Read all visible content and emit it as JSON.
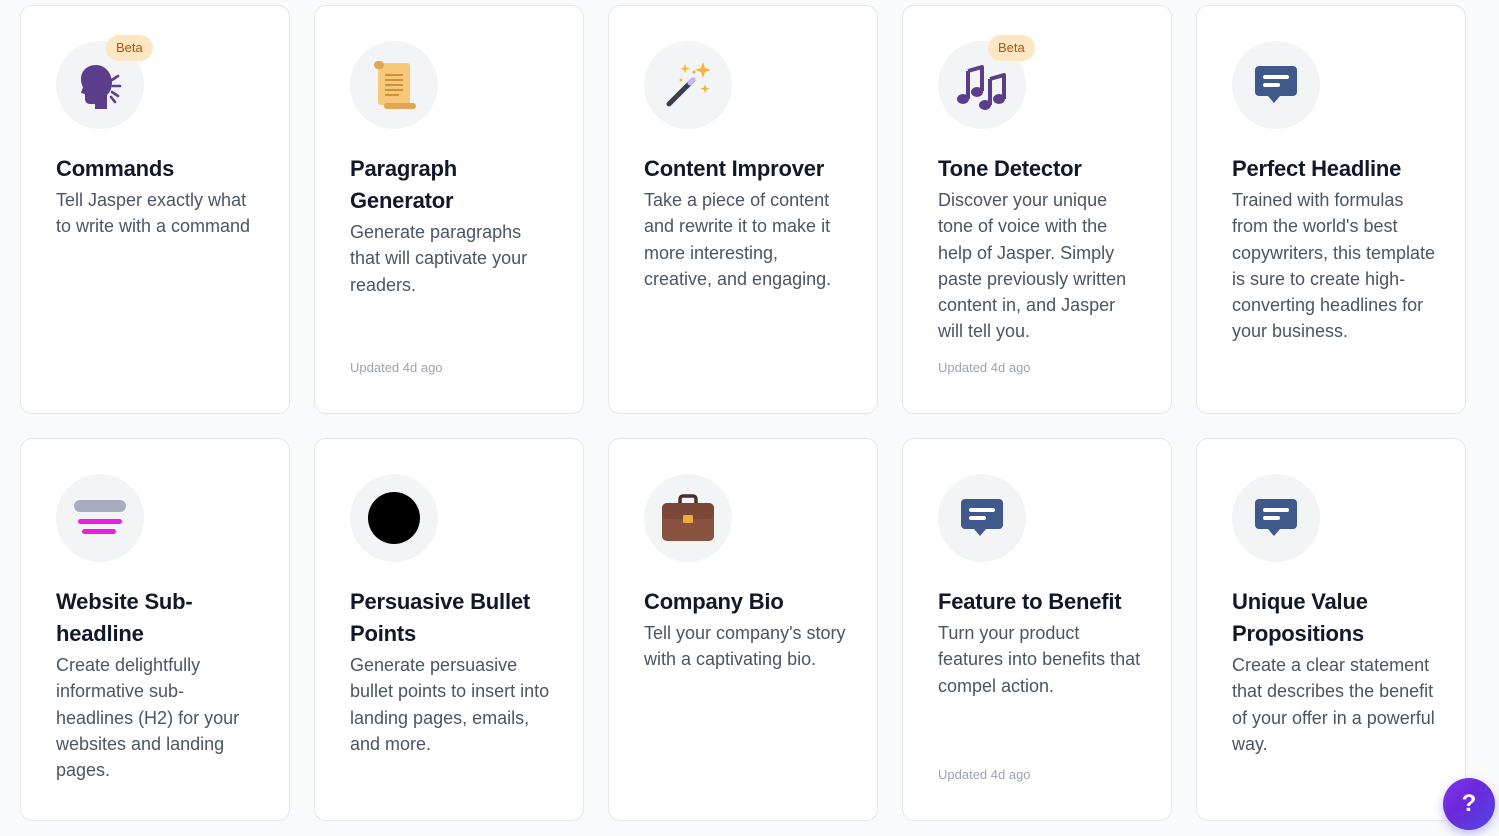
{
  "cards": [
    {
      "icon": "speaking-head-icon",
      "beta": "Beta",
      "title": "Commands",
      "desc": "Tell Jasper exactly what to write with a command",
      "updated": ""
    },
    {
      "icon": "scroll-icon",
      "beta": "",
      "title": "Paragraph Generator",
      "desc": "Generate paragraphs that will captivate your readers.",
      "updated": "Updated 4d ago"
    },
    {
      "icon": "magic-wand-icon",
      "beta": "",
      "title": "Content Improver",
      "desc": "Take a piece of content and rewrite it to make it more interesting, creative, and engaging.",
      "updated": ""
    },
    {
      "icon": "music-notes-icon",
      "beta": "Beta",
      "title": "Tone Detector",
      "desc": "Discover your unique tone of voice with the help of Jasper. Simply paste previously written content in, and Jasper will tell you.",
      "updated": "Updated 4d ago"
    },
    {
      "icon": "chat-bubble-icon",
      "beta": "",
      "title": "Perfect Headline",
      "desc": "Trained with formulas from the world's best copywriters, this template is sure to create high-converting headlines for your business.",
      "updated": ""
    },
    {
      "icon": "subheadline-icon",
      "beta": "",
      "title": "Website Sub-headline",
      "desc": "Create delightfully informative sub-headlines (H2) for your websites and landing pages.",
      "updated": ""
    },
    {
      "icon": "black-circle-icon",
      "beta": "",
      "title": "Persuasive Bullet Points",
      "desc": "Generate persuasive bullet points to insert into landing pages, emails, and more.",
      "updated": ""
    },
    {
      "icon": "briefcase-icon",
      "beta": "",
      "title": "Company Bio",
      "desc": "Tell your company's story with a captivating bio.",
      "updated": ""
    },
    {
      "icon": "chat-bubble-icon",
      "beta": "",
      "title": "Feature to Benefit",
      "desc": "Turn your product features into benefits that compel action.",
      "updated": "Updated 4d ago"
    },
    {
      "icon": "chat-bubble-icon",
      "beta": "",
      "title": "Unique Value Propositions",
      "desc": "Create a clear statement that describes the benefit of your offer in a powerful way.",
      "updated": ""
    }
  ],
  "help_button": {
    "label": "?"
  },
  "colors": {
    "accent": "#6d28d9",
    "beta_bg": "#fde6c2",
    "beta_text": "#b45309"
  }
}
